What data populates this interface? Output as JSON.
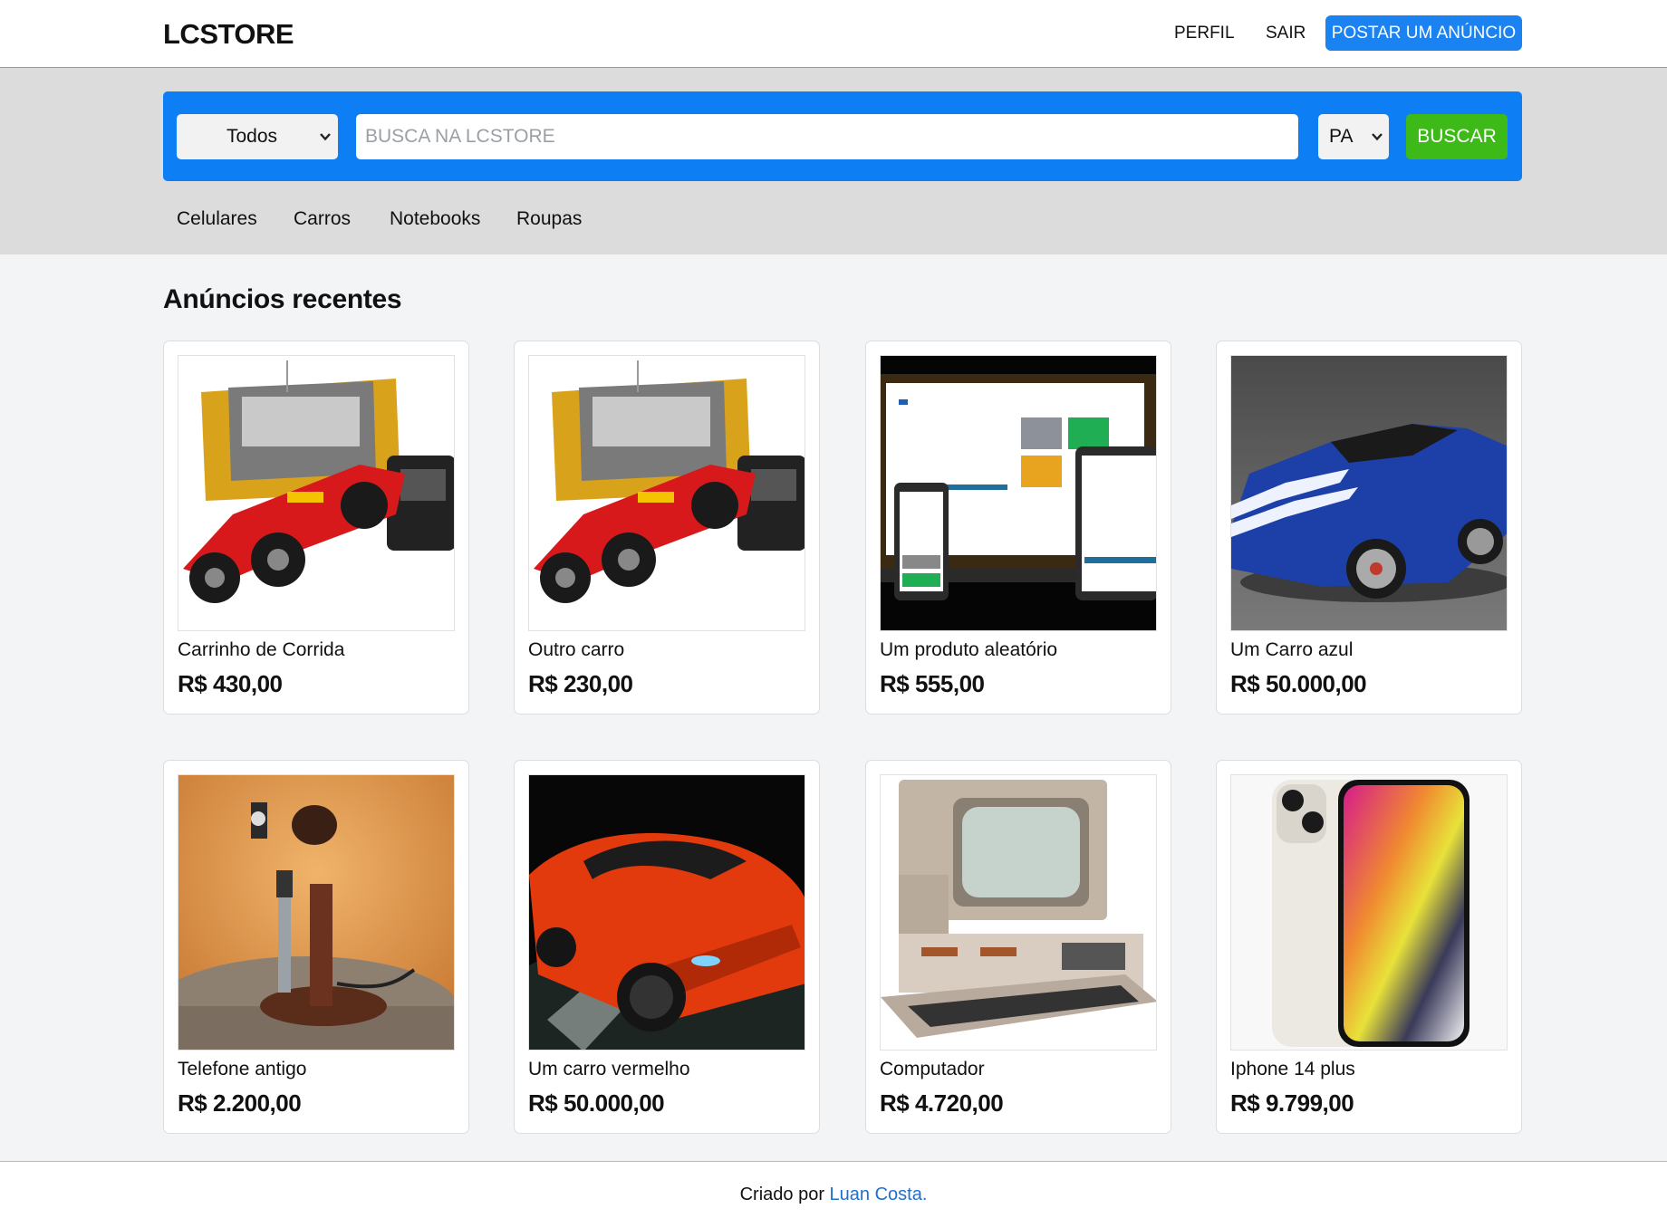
{
  "header": {
    "logo": "LCSTORE",
    "nav": {
      "profile": "PERFIL",
      "logout": "SAIR",
      "post_ad": "POSTAR UM ANÚNCIO"
    }
  },
  "search": {
    "category_selected": "Todos",
    "placeholder": "BUSCA NA LCSTORE",
    "state_selected": "PA",
    "button": "BUSCAR"
  },
  "categories": [
    "Celulares",
    "Carros",
    "Notebooks",
    "Roupas"
  ],
  "main": {
    "title": "Anúncios recentes",
    "ads": [
      {
        "name": "Carrinho de Corrida",
        "price": "R$ 430,00",
        "image": "rc-race-car-toy"
      },
      {
        "name": "Outro carro",
        "price": "R$ 230,00",
        "image": "rc-race-car-toy"
      },
      {
        "name": "Um produto aleatório",
        "price": "R$ 555,00",
        "image": "imc-calculator-devices"
      },
      {
        "name": "Um Carro azul",
        "price": "R$ 50.000,00",
        "image": "blue-sports-car"
      },
      {
        "name": "Telefone antigo",
        "price": "R$ 2.200,00",
        "image": "antique-telephone"
      },
      {
        "name": "Um carro vermelho",
        "price": "R$ 50.000,00",
        "image": "orange-supercar"
      },
      {
        "name": "Computador",
        "price": "R$ 4.720,00",
        "image": "retro-computer"
      },
      {
        "name": "Iphone 14 plus",
        "price": "R$ 9.799,00",
        "image": "iphone-14-plus"
      }
    ]
  },
  "footer": {
    "prefix": "Criado por",
    "author": "Luan Costa."
  },
  "colors": {
    "primary": "#0e7ef4",
    "search_button": "#3dba18",
    "link": "#1f6fd1"
  }
}
